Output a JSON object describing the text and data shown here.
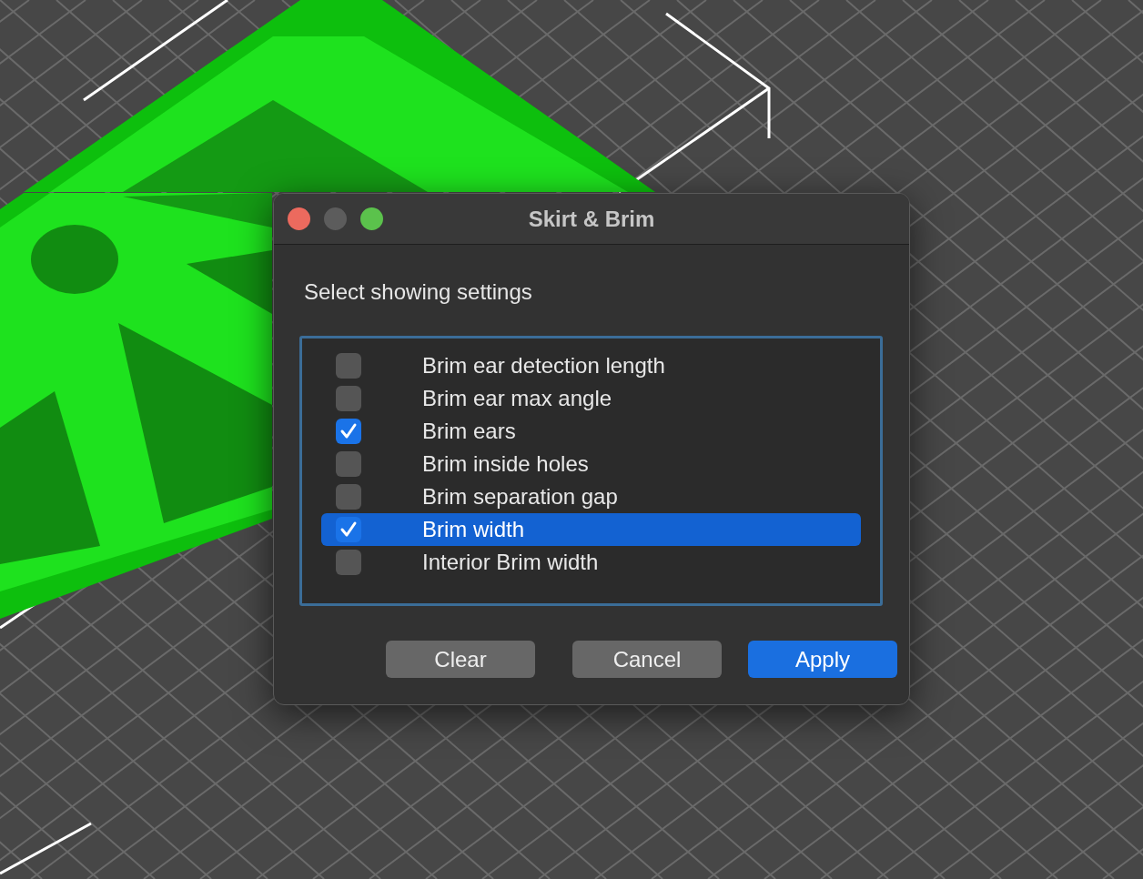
{
  "window": {
    "title": "Skirt & Brim"
  },
  "prompt": "Select showing settings",
  "items": [
    {
      "label": "Brim ear detection length",
      "checked": false,
      "selected": false
    },
    {
      "label": "Brim ear max angle",
      "checked": false,
      "selected": false
    },
    {
      "label": "Brim ears",
      "checked": true,
      "selected": false
    },
    {
      "label": "Brim inside holes",
      "checked": false,
      "selected": false
    },
    {
      "label": "Brim separation gap",
      "checked": false,
      "selected": false
    },
    {
      "label": "Brim width",
      "checked": true,
      "selected": true
    },
    {
      "label": "Interior Brim width",
      "checked": false,
      "selected": false
    }
  ],
  "buttons": [
    {
      "label": "Clear",
      "kind": "default"
    },
    {
      "label": "Cancel",
      "kind": "default"
    },
    {
      "label": "Apply",
      "kind": "primary"
    }
  ]
}
